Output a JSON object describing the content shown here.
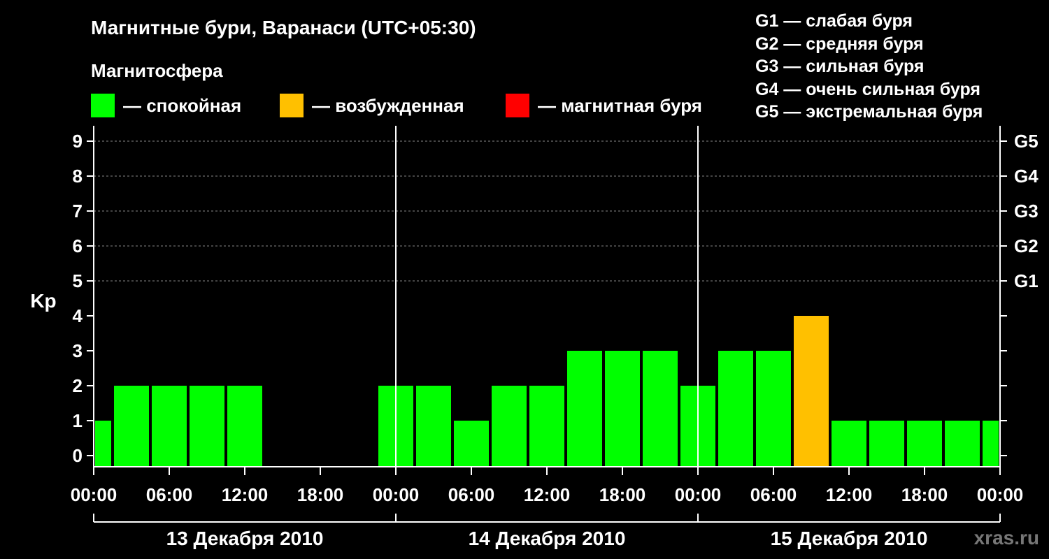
{
  "title": "Магнитные бури, Варанаси (UTC+05:30)",
  "subtitle": "Магнитосфера",
  "legend": [
    {
      "label": "— спокойная",
      "color": "#00ff00"
    },
    {
      "label": "— возбужденная",
      "color": "#ffc000"
    },
    {
      "label": "— магнитная буря",
      "color": "#ff0000"
    }
  ],
  "g_legend": [
    "G1 — слабая буря",
    "G2 — средняя буря",
    "G3 — сильная буря",
    "G4 — очень сильная буря",
    "G5 — экстремальная буря"
  ],
  "watermark": "xras.ru",
  "chart_data": {
    "type": "bar",
    "ylabel": "Kp",
    "ylim": [
      0,
      9
    ],
    "y_ticks": [
      0,
      1,
      2,
      3,
      4,
      5,
      6,
      7,
      8,
      9
    ],
    "g_labels": [
      {
        "kp": 5,
        "label": "G1"
      },
      {
        "kp": 6,
        "label": "G2"
      },
      {
        "kp": 7,
        "label": "G3"
      },
      {
        "kp": 8,
        "label": "G4"
      },
      {
        "kp": 9,
        "label": "G5"
      }
    ],
    "x_tick_labels": [
      "00:00",
      "06:00",
      "12:00",
      "18:00",
      "00:00",
      "06:00",
      "12:00",
      "18:00",
      "00:00",
      "06:00",
      "12:00",
      "18:00",
      "00:00"
    ],
    "days": [
      "13 Декабря 2010",
      "14 Декабря 2010",
      "15 Декабря 2010"
    ],
    "bars": [
      {
        "day": 0,
        "start_hour": 0,
        "end_hour": 1.5,
        "value": 1,
        "state": "quiet"
      },
      {
        "day": 0,
        "start_hour": 1.5,
        "end_hour": 4.5,
        "value": 2,
        "state": "quiet"
      },
      {
        "day": 0,
        "start_hour": 4.5,
        "end_hour": 7.5,
        "value": 2,
        "state": "quiet"
      },
      {
        "day": 0,
        "start_hour": 7.5,
        "end_hour": 10.5,
        "value": 2,
        "state": "quiet"
      },
      {
        "day": 0,
        "start_hour": 10.5,
        "end_hour": 13.5,
        "value": 2,
        "state": "quiet"
      },
      {
        "day": 0,
        "start_hour": 22.5,
        "end_hour": 25.5,
        "value": 2,
        "state": "quiet"
      },
      {
        "day": 1,
        "start_hour": 1.5,
        "end_hour": 4.5,
        "value": 2,
        "state": "quiet"
      },
      {
        "day": 1,
        "start_hour": 4.5,
        "end_hour": 7.5,
        "value": 1,
        "state": "quiet"
      },
      {
        "day": 1,
        "start_hour": 7.5,
        "end_hour": 10.5,
        "value": 2,
        "state": "quiet"
      },
      {
        "day": 1,
        "start_hour": 10.5,
        "end_hour": 13.5,
        "value": 2,
        "state": "quiet"
      },
      {
        "day": 1,
        "start_hour": 13.5,
        "end_hour": 16.5,
        "value": 3,
        "state": "quiet"
      },
      {
        "day": 1,
        "start_hour": 16.5,
        "end_hour": 19.5,
        "value": 3,
        "state": "quiet"
      },
      {
        "day": 1,
        "start_hour": 19.5,
        "end_hour": 22.5,
        "value": 3,
        "state": "quiet"
      },
      {
        "day": 1,
        "start_hour": 22.5,
        "end_hour": 25.5,
        "value": 2,
        "state": "quiet"
      },
      {
        "day": 2,
        "start_hour": 1.5,
        "end_hour": 4.5,
        "value": 3,
        "state": "quiet"
      },
      {
        "day": 2,
        "start_hour": 4.5,
        "end_hour": 7.5,
        "value": 3,
        "state": "quiet"
      },
      {
        "day": 2,
        "start_hour": 7.5,
        "end_hour": 10.5,
        "value": 4,
        "state": "active"
      },
      {
        "day": 2,
        "start_hour": 10.5,
        "end_hour": 13.5,
        "value": 1,
        "state": "quiet"
      },
      {
        "day": 2,
        "start_hour": 13.5,
        "end_hour": 16.5,
        "value": 1,
        "state": "quiet"
      },
      {
        "day": 2,
        "start_hour": 16.5,
        "end_hour": 19.5,
        "value": 1,
        "state": "quiet"
      },
      {
        "day": 2,
        "start_hour": 19.5,
        "end_hour": 22.5,
        "value": 1,
        "state": "quiet"
      },
      {
        "day": 2,
        "start_hour": 22.5,
        "end_hour": 24,
        "value": 1,
        "state": "quiet"
      }
    ],
    "colors": {
      "quiet": "#00ff00",
      "active": "#ffc000",
      "storm": "#ff0000"
    },
    "grid": true
  }
}
